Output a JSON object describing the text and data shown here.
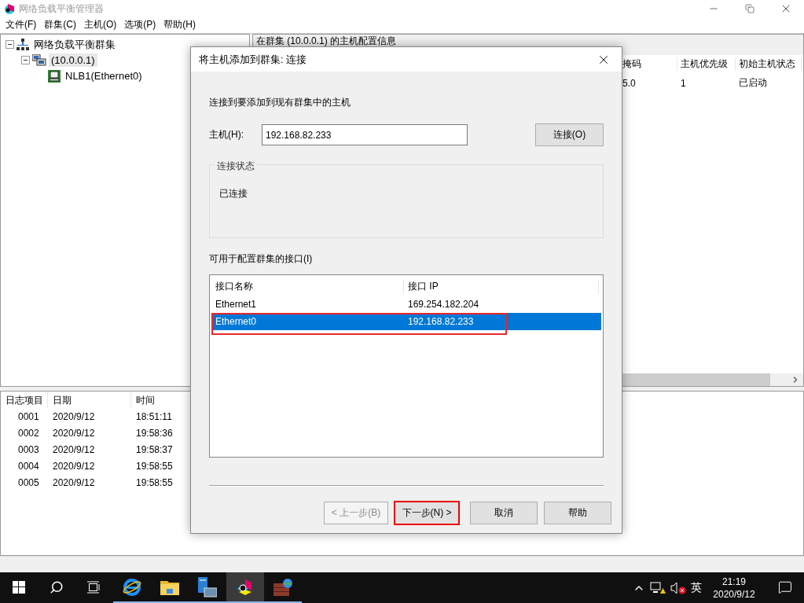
{
  "window": {
    "title": "网络负载平衡管理器"
  },
  "menu": [
    "文件(F)",
    "群集(C)",
    "主机(O)",
    "选项(P)",
    "帮助(H)"
  ],
  "tree": [
    {
      "label": "网络负载平衡群集",
      "kind": "root",
      "selected": false,
      "expanded": true,
      "children": [
        {
          "label": "(10.0.0.1)",
          "kind": "cluster",
          "selected": true,
          "expanded": true,
          "children": [
            {
              "label": "NLB1(Ethernet0)",
              "kind": "host",
              "selected": false
            }
          ]
        }
      ]
    }
  ],
  "host_panel": {
    "title": "在群集 (10.0.0.1) 的主机配置信息",
    "columns": [
      "掩码",
      "主机优先级",
      "初始主机状态"
    ],
    "rows": [
      [
        "5.0",
        "1",
        "已启动"
      ]
    ]
  },
  "log": {
    "columns": [
      "日志项目",
      "日期",
      "时间"
    ],
    "rows": [
      [
        "0001",
        "2020/9/12",
        "18:51:11"
      ],
      [
        "0002",
        "2020/9/12",
        "19:58:36"
      ],
      [
        "0003",
        "2020/9/12",
        "19:58:37"
      ],
      [
        "0004",
        "2020/9/12",
        "19:58:55"
      ],
      [
        "0005",
        "2020/9/12",
        "19:58:55"
      ]
    ]
  },
  "dialog": {
    "title": "将主机添加到群集: 连接",
    "intro": "连接到要添加到现有群集中的主机",
    "host_label": "主机(H):",
    "host_value": "192.168.82.233",
    "connect_button": "连接(O)",
    "status_group": "连接状态",
    "status_text": "已连接",
    "interfaces_label": "可用于配置群集的接口(I)",
    "columns": [
      "接口名称",
      "接口 IP"
    ],
    "interfaces": [
      {
        "name": "Ethernet1",
        "ip": "169.254.182.204",
        "selected": false,
        "highlighted": false
      },
      {
        "name": "Ethernet0",
        "ip": "192.168.82.233",
        "selected": true,
        "highlighted": true
      }
    ],
    "buttons": [
      {
        "label": "< 上一步(B)",
        "disabled": true,
        "highlighted": false
      },
      {
        "label": "下一步(N) >",
        "disabled": false,
        "highlighted": true
      },
      {
        "label": "取消",
        "disabled": false,
        "highlighted": false
      },
      {
        "label": "帮助",
        "disabled": false,
        "highlighted": false
      }
    ]
  },
  "taskbar": {
    "apps": [
      {
        "kind": "ie",
        "active": false
      },
      {
        "kind": "explorer",
        "active": false
      },
      {
        "kind": "server",
        "active": false
      },
      {
        "kind": "nlb",
        "active": true
      },
      {
        "kind": "firewall",
        "active": false
      }
    ],
    "ime": "英",
    "time": "21:19",
    "date": "2020/9/12"
  }
}
